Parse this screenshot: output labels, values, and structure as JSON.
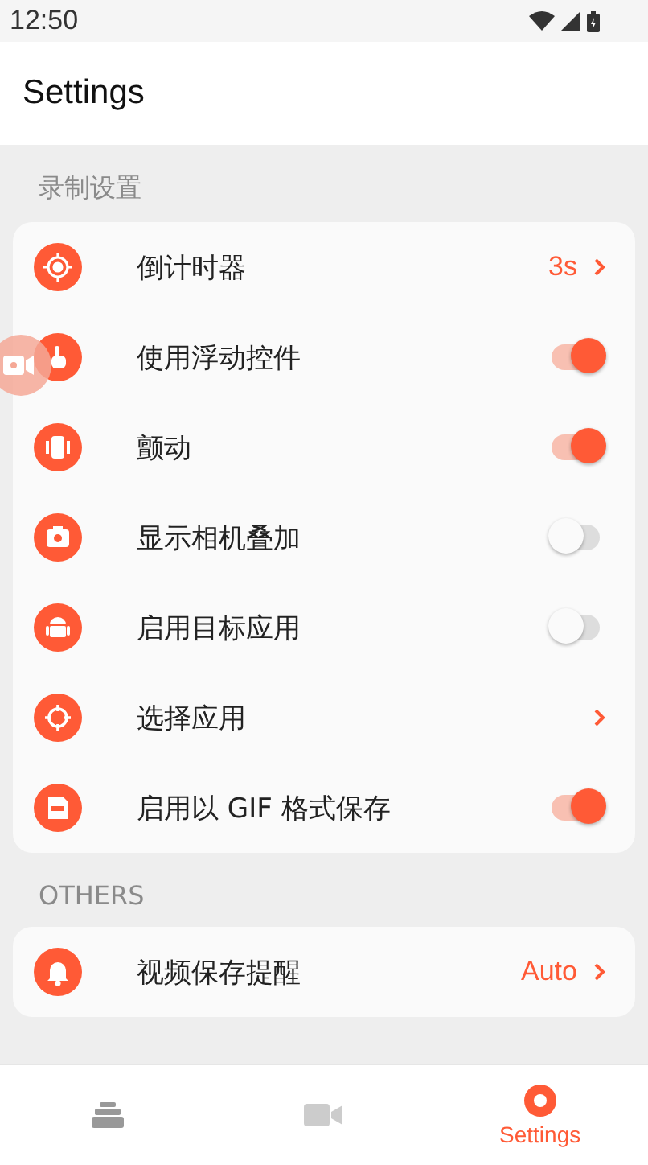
{
  "status_bar": {
    "time": "12:50"
  },
  "header": {
    "title": "Settings"
  },
  "sections": [
    {
      "title": "录制设置",
      "rows": [
        {
          "kind": "value",
          "label": "倒计时器",
          "value": "3s"
        },
        {
          "kind": "toggle",
          "label": "使用浮动控件",
          "on": true
        },
        {
          "kind": "toggle",
          "label": "颤动",
          "on": true
        },
        {
          "kind": "toggle",
          "label": "显示相机叠加",
          "on": false
        },
        {
          "kind": "toggle",
          "label": "启用目标应用",
          "on": false
        },
        {
          "kind": "link",
          "label": "选择应用"
        },
        {
          "kind": "toggle",
          "label": "启用以 GIF 格式保存",
          "on": true
        }
      ]
    },
    {
      "title": "OTHERS",
      "rows": [
        {
          "kind": "value",
          "label": "视频保存提醒",
          "value": "Auto"
        }
      ]
    }
  ],
  "bottom_nav": [
    {
      "selected": false
    },
    {
      "selected": false
    },
    {
      "label": "Settings",
      "selected": true
    }
  ]
}
